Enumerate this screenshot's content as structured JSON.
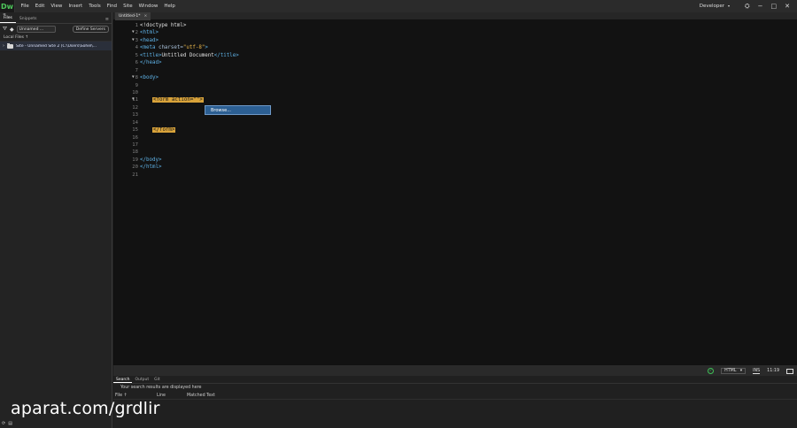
{
  "app": {
    "logo": "Dw",
    "menu": [
      "File",
      "Edit",
      "View",
      "Insert",
      "Tools",
      "Find",
      "Site",
      "Window",
      "Help"
    ],
    "workspace": "Developer",
    "workspace_caret": "▾",
    "sync_icon": "⛭",
    "window_buttons": [
      "−",
      "□",
      "✕"
    ]
  },
  "files_panel": {
    "grip": "◂▸",
    "tabs": [
      "Files",
      "Snippets"
    ],
    "menu_icon": "≡",
    "site_select": "Unnamed ...",
    "define_servers": "Define Servers",
    "local_files": "Local Files ↑",
    "site_row": "Site - Unnamed Site 2 (C:\\Users\\Sohel\\...",
    "site_chevron": "›"
  },
  "document": {
    "tab": "Untitled-1*",
    "tab_close": "×"
  },
  "editor": {
    "line_numbers": [
      "1",
      "2",
      "3",
      "4",
      "5",
      "6",
      "7",
      "8",
      "9",
      "10",
      "11",
      "12",
      "13",
      "14",
      "15",
      "16",
      "17",
      "18",
      "19",
      "20",
      "21"
    ],
    "fold_markers": {
      "2": "▼",
      "3": "▼",
      "8": "▼",
      "11": "▼"
    },
    "lines": [
      [
        {
          "t": "<!doctype html>",
          "c": "doctype"
        }
      ],
      [
        {
          "t": "<html>",
          "c": "tag"
        }
      ],
      [
        {
          "t": "<head>",
          "c": "tag"
        }
      ],
      [
        {
          "t": "<meta ",
          "c": "tag"
        },
        {
          "t": "charset=",
          "c": "attr"
        },
        {
          "t": "\"utf-8\"",
          "c": "str"
        },
        {
          "t": ">",
          "c": "tag"
        }
      ],
      [
        {
          "t": "<title>",
          "c": "tag"
        },
        {
          "t": "Untitled Document",
          "c": "txt"
        },
        {
          "t": "</title>",
          "c": "tag"
        }
      ],
      [
        {
          "t": "</head>",
          "c": "tag"
        }
      ],
      [],
      [
        {
          "t": "<body>",
          "c": "tag"
        }
      ],
      [],
      [],
      [
        {
          "t": "    ",
          "c": "txt"
        },
        {
          "t": "<form action=\"\">",
          "c": "hl"
        }
      ],
      [],
      [],
      [],
      [
        {
          "t": "    ",
          "c": "txt"
        },
        {
          "t": "</form>",
          "c": "hl"
        }
      ],
      [],
      [],
      [],
      [
        {
          "t": "</body>",
          "c": "tag"
        }
      ],
      [
        {
          "t": "</html>",
          "c": "tag"
        }
      ],
      []
    ],
    "popup": "Browse..."
  },
  "status_bar": {
    "ok_icon": "✓",
    "language": "HTML",
    "language_caret": "▾",
    "mode": "INS",
    "position": "11:19"
  },
  "output_panel": {
    "tabs": [
      "Search",
      "Output",
      "Git"
    ],
    "message": "Your search results are displayed here",
    "columns": [
      "File ↑",
      "Line",
      "Matched Text"
    ]
  },
  "watermark": "aparat.com/grdlir"
}
